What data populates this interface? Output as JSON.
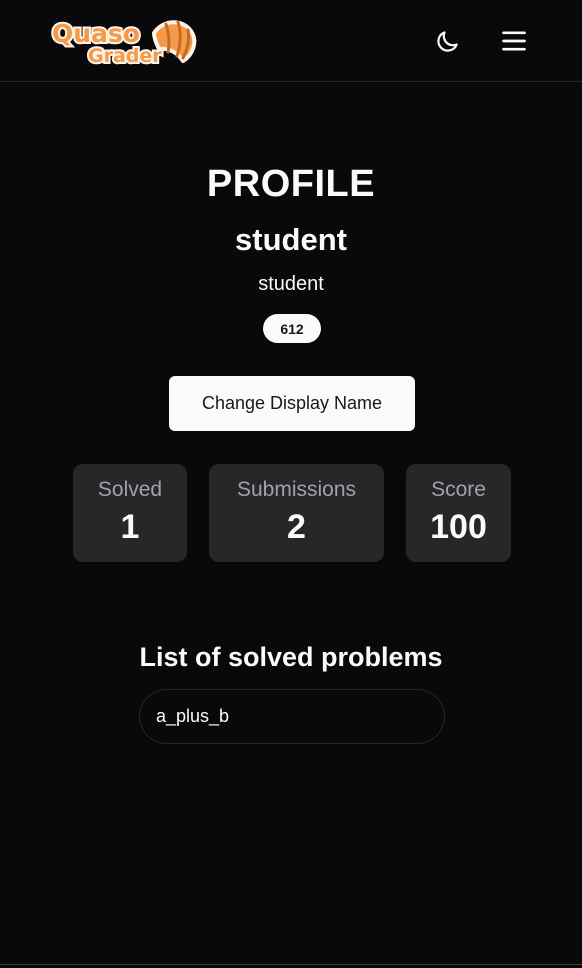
{
  "header": {
    "logo_line1": "Quaso",
    "logo_line2": "Grader",
    "theme_icon": "moon-icon",
    "menu_icon": "hamburger-menu-icon"
  },
  "profile": {
    "title": "PROFILE",
    "display_name": "student",
    "username": "student",
    "user_id": "612",
    "change_name_label": "Change Display Name"
  },
  "stats": {
    "solved_label": "Solved",
    "solved_value": "1",
    "submissions_label": "Submissions",
    "submissions_value": "2",
    "score_label": "Score",
    "score_value": "100"
  },
  "solved_section": {
    "title": "List of solved problems",
    "items": [
      "a_plus_b"
    ]
  },
  "colors": {
    "background": "#09090b",
    "card": "#27272a",
    "muted_text": "#a1a1aa",
    "logo_orange": "#f59a4a"
  }
}
